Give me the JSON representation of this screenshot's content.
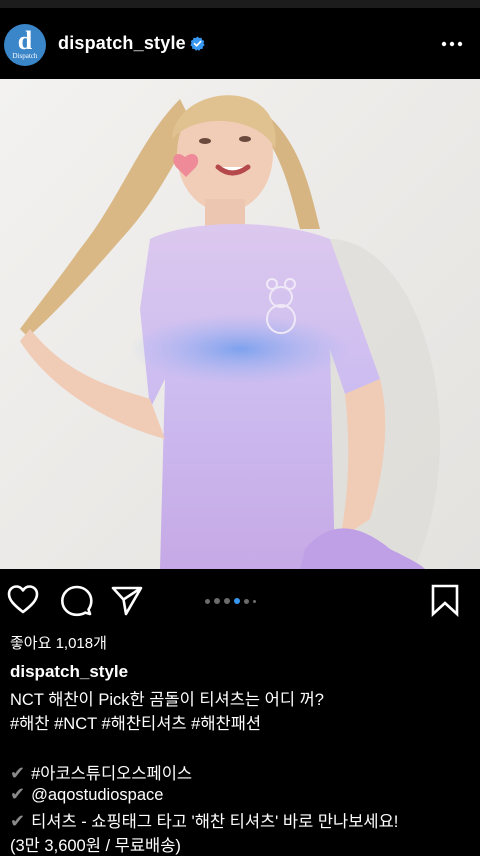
{
  "header": {
    "username": "dispatch_style",
    "avatar_letter": "d",
    "avatar_caption": "Dispatch",
    "verified": true,
    "more_icon": "ellipsis-icon"
  },
  "post": {
    "image_alt": "",
    "carousel": {
      "count": 6,
      "active_index": 3
    },
    "likes_text": "좋아요 1,018개",
    "caption": {
      "username": "dispatch_style",
      "line1": "NCT 해찬이 Pick한 곰돌이 티셔츠는 어디 꺼?",
      "line2": "#해찬 #NCT #해찬티셔츠 #해찬패션",
      "check1": "#아코스튜디오스페이스",
      "check2": "@aqostudiospace",
      "check3": "티셔츠 - 쇼핑태그 타고 '해찬 티셔츠' 바로 만나보세요!",
      "line_last": "(3만 3,600원 / 무료배송)",
      "check_glyph": "✔"
    }
  },
  "colors": {
    "background": "#000000",
    "accent_blue": "#3897f0",
    "avatar_bg": "#3a86c8"
  }
}
